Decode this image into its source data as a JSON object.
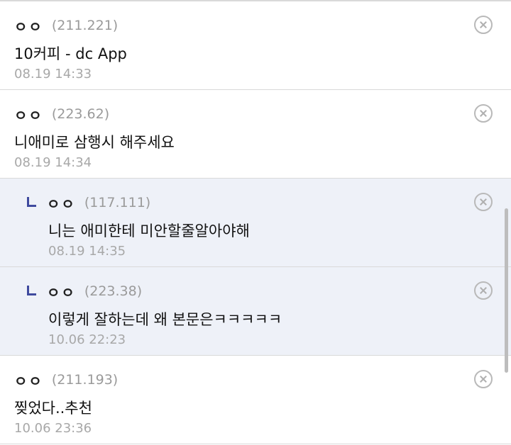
{
  "comments": [
    {
      "nick": "ㅇㅇ",
      "ip": "(211.221)",
      "text": "10커피 - dc App",
      "date": "08.19 14:33",
      "reply": false
    },
    {
      "nick": "ㅇㅇ",
      "ip": "(223.62)",
      "text": "니애미로 삼행시 해주세요",
      "date": "08.19 14:34",
      "reply": false
    },
    {
      "nick": "ㅇㅇ",
      "ip": "(117.111)",
      "text": "니는 애미한테 미안할줄알아야해",
      "date": "08.19 14:35",
      "reply": true
    },
    {
      "nick": "ㅇㅇ",
      "ip": "(223.38)",
      "text": "이렇게 잘하는데 왜 본문은ㅋㅋㅋㅋㅋ",
      "date": "10.06 22:23",
      "reply": true
    },
    {
      "nick": "ㅇㅇ",
      "ip": "(211.193)",
      "text": "찢었다..추천",
      "date": "10.06 23:36",
      "reply": false
    }
  ],
  "icons": {
    "delete": "close-circle-icon",
    "reply": "reply-arrow-icon"
  },
  "colors": {
    "reply_background": "#eef1f8",
    "reply_arrow": "#3f4a9e",
    "meta_text": "#9a9a9a"
  }
}
